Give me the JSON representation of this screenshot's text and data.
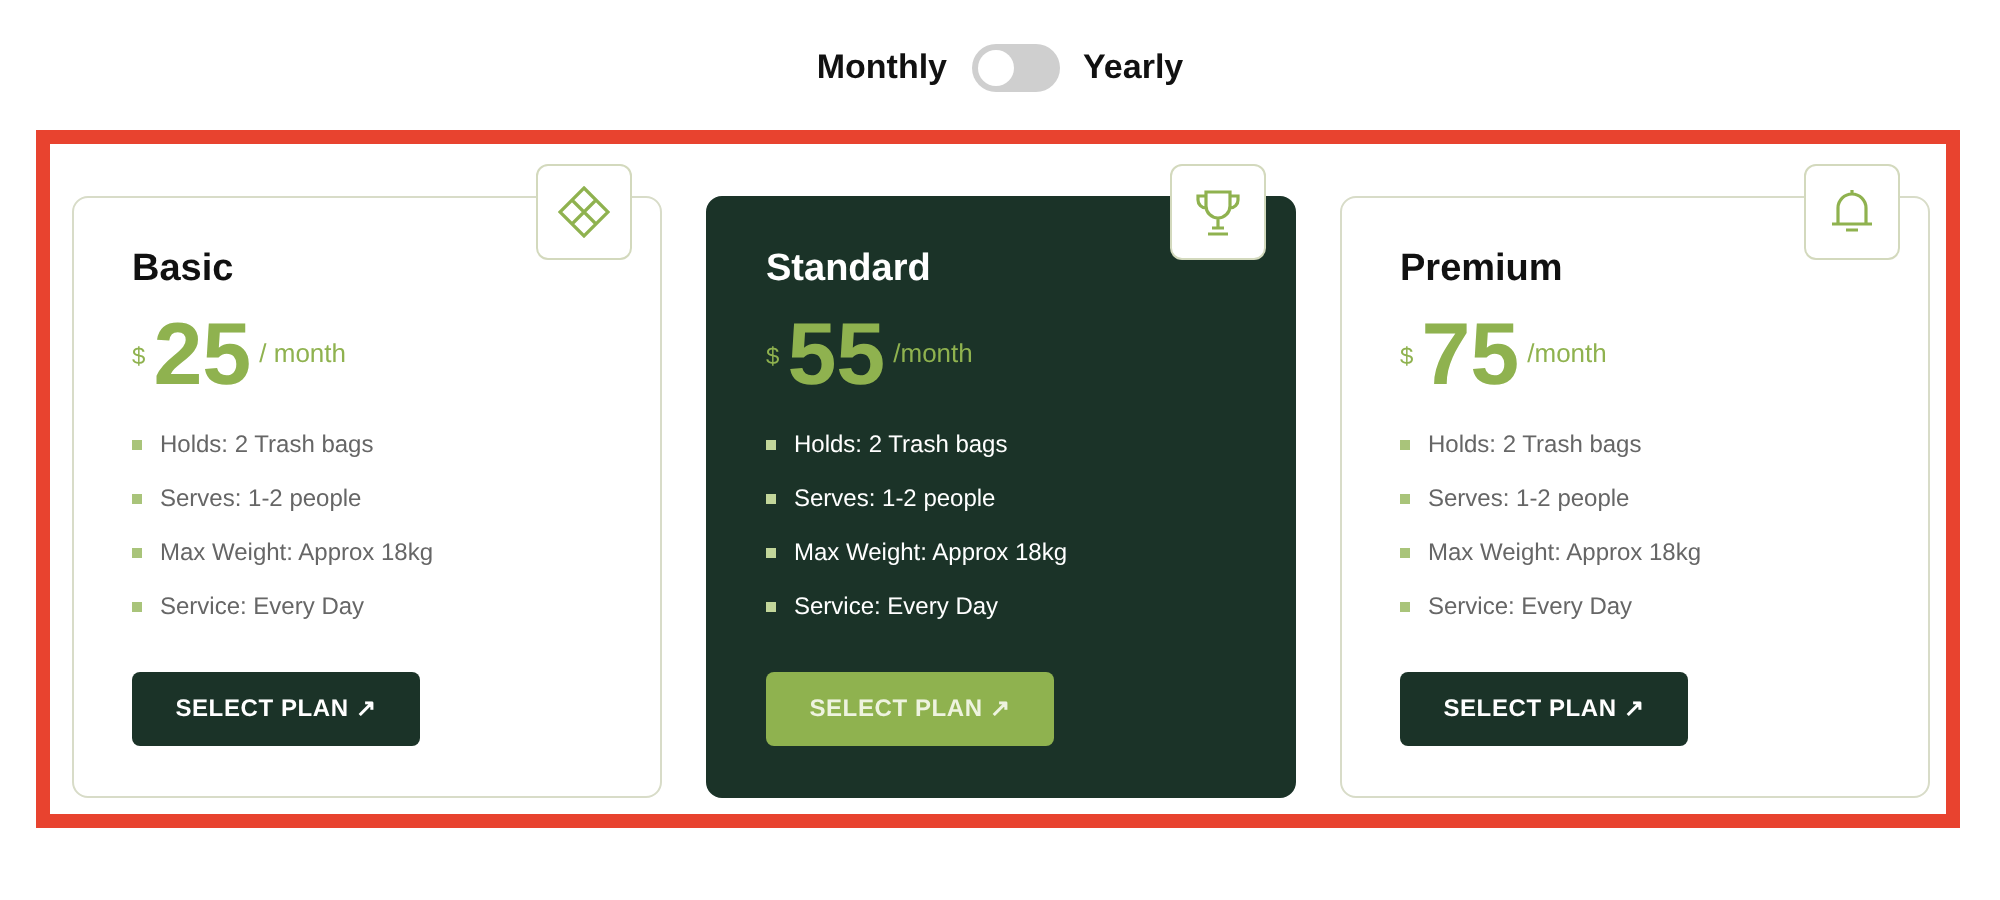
{
  "billing_toggle": {
    "left_label": "Monthly",
    "right_label": "Yearly",
    "on": false
  },
  "plans": [
    {
      "name": "Basic",
      "featured": false,
      "kind": "diamond",
      "currency": "$",
      "price": "25",
      "period": "/ month",
      "features": [
        "Holds: 2 Trash bags",
        "Serves: 1-2 people",
        "Max Weight: Approx 18kg",
        "Service: Every Day"
      ],
      "button": "SELECT PLAN ↗"
    },
    {
      "name": "Standard",
      "featured": true,
      "kind": "trophy",
      "currency": "$",
      "price": "55",
      "period": "/month",
      "features": [
        "Holds: 2 Trash bags",
        "Serves: 1-2 people",
        "Max Weight: Approx 18kg",
        "Service: Every Day"
      ],
      "button": "SELECT PLAN ↗"
    },
    {
      "name": "Premium",
      "featured": false,
      "kind": "bell",
      "currency": "$",
      "price": "75",
      "period": "/month",
      "features": [
        "Holds: 2 Trash bags",
        "Serves: 1-2 people",
        "Max Weight: Approx 18kg",
        "Service: Every Day"
      ],
      "button": "SELECT PLAN ↗"
    }
  ]
}
